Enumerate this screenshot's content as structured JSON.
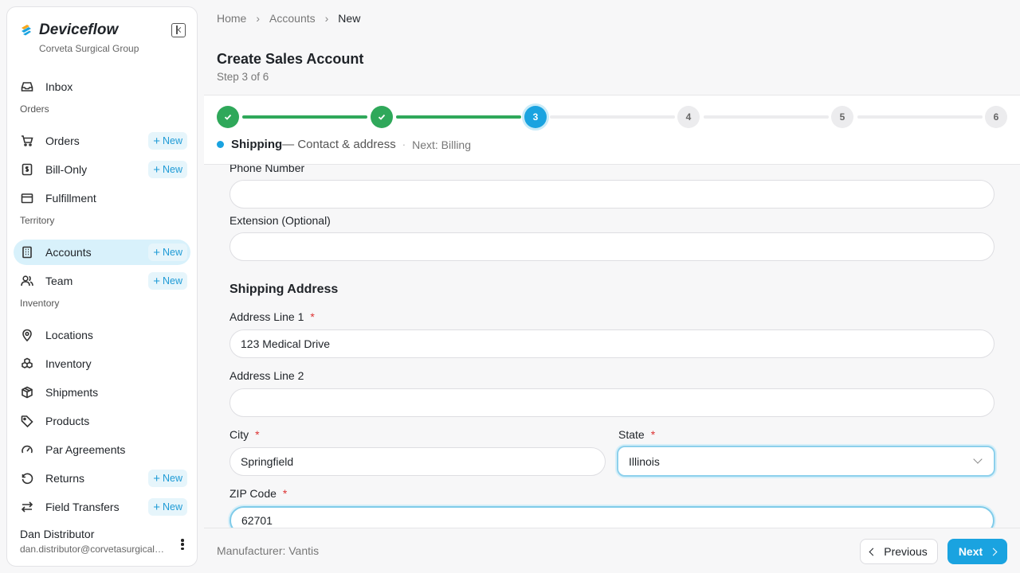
{
  "brand": {
    "name": "Deviceflow",
    "org": "Corveta Surgical Group"
  },
  "nav": {
    "inbox": "Inbox",
    "sections": {
      "orders": "Orders",
      "territory": "Territory",
      "inventory": "Inventory"
    },
    "items": [
      {
        "label": "Orders",
        "badge": "New"
      },
      {
        "label": "Bill-Only",
        "badge": "New"
      },
      {
        "label": "Fulfillment"
      },
      {
        "label": "Accounts",
        "badge": "New",
        "active": true
      },
      {
        "label": "Team",
        "badge": "New"
      },
      {
        "label": "Locations"
      },
      {
        "label": "Inventory"
      },
      {
        "label": "Shipments"
      },
      {
        "label": "Products"
      },
      {
        "label": "Par Agreements"
      },
      {
        "label": "Returns",
        "badge": "New"
      },
      {
        "label": "Field Transfers",
        "badge": "New"
      }
    ]
  },
  "user": {
    "name": "Dan Distributor",
    "email": "dan.distributor@corvetasurgicalgroup.com"
  },
  "breadcrumb": {
    "home": "Home",
    "accounts": "Accounts",
    "current": "New"
  },
  "page": {
    "title": "Create Sales Account",
    "step": "Step 3 of 6"
  },
  "stepper": {
    "steps": [
      "3",
      "4",
      "5",
      "6"
    ],
    "current_name": "Shipping",
    "current_desc": "— Contact & address",
    "sep": "·",
    "next": "Next: Billing"
  },
  "form": {
    "phone_label": "Phone Number",
    "phone_value": "",
    "ext_label": "Extension (Optional)",
    "ext_value": "",
    "shipping_title": "Shipping Address",
    "addr1_label": "Address Line 1",
    "addr1_value": "123 Medical Drive",
    "addr2_label": "Address Line 2",
    "addr2_value": "",
    "city_label": "City",
    "city_value": "Springfield",
    "state_label": "State",
    "state_value": "Illinois",
    "zip_label": "ZIP Code",
    "zip_value": "62701",
    "required_mark": "*"
  },
  "footer": {
    "manufacturer": "Manufacturer: Vantis",
    "prev": "Previous",
    "next": "Next"
  },
  "colors": {
    "accent": "#1aa3e0",
    "success": "#2fa85a",
    "required": "#dd3333"
  }
}
